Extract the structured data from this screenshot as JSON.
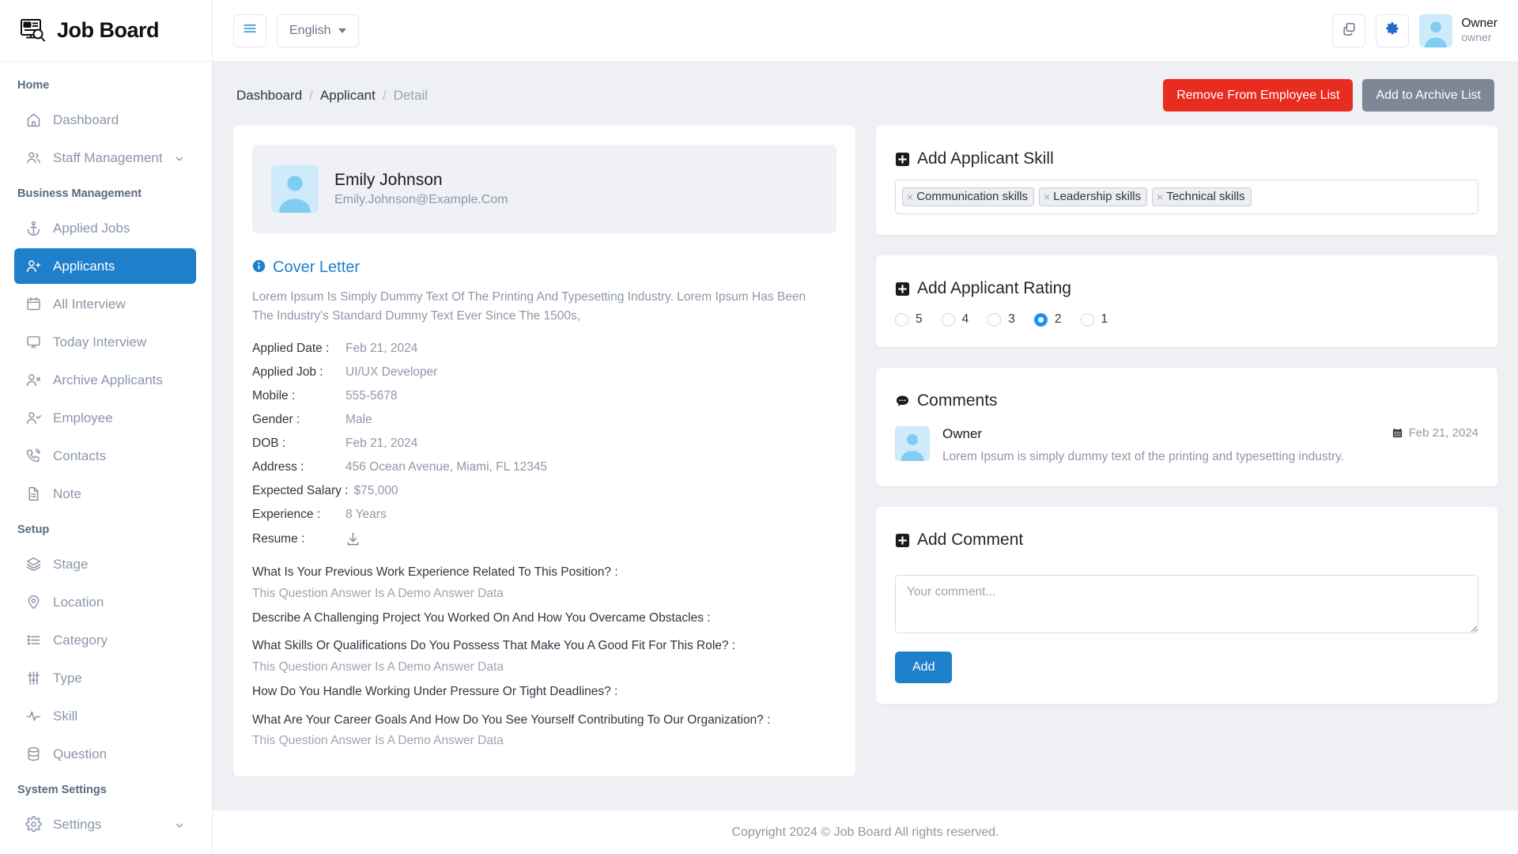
{
  "brand": {
    "name": "Job Board",
    "logo_icon": "job-certificate-search-icon"
  },
  "sidebar": {
    "sections": [
      {
        "label": "Home",
        "items": [
          {
            "label": "Dashboard",
            "icon": "home-icon",
            "active": false
          },
          {
            "label": "Staff Management",
            "icon": "users-icon",
            "active": false,
            "chevron": "chevron-down-icon"
          }
        ]
      },
      {
        "label": "Business Management",
        "items": [
          {
            "label": "Applied Jobs",
            "icon": "anchor-icon",
            "active": false
          },
          {
            "label": "Applicants",
            "icon": "user-plus-icon",
            "active": true
          },
          {
            "label": "All Interview",
            "icon": "calendar-icon",
            "active": false
          },
          {
            "label": "Today Interview",
            "icon": "screen-icon",
            "active": false
          },
          {
            "label": "Archive Applicants",
            "icon": "user-x-icon",
            "active": false
          },
          {
            "label": "Employee",
            "icon": "user-check-icon",
            "active": false
          },
          {
            "label": "Contacts",
            "icon": "phone-call-icon",
            "active": false
          },
          {
            "label": "Note",
            "icon": "file-text-icon",
            "active": false
          }
        ]
      },
      {
        "label": "Setup",
        "items": [
          {
            "label": "Stage",
            "icon": "layers-icon",
            "active": false
          },
          {
            "label": "Location",
            "icon": "map-pin-icon",
            "active": false
          },
          {
            "label": "Category",
            "icon": "list-icon",
            "active": false
          },
          {
            "label": "Type",
            "icon": "sliders-icon",
            "active": false
          },
          {
            "label": "Skill",
            "icon": "activity-icon",
            "active": false
          },
          {
            "label": "Question",
            "icon": "database-icon",
            "active": false
          }
        ]
      },
      {
        "label": "System Settings",
        "items": [
          {
            "label": "Settings",
            "icon": "gear-icon",
            "active": false,
            "chevron": "chevron-down-icon"
          }
        ]
      }
    ]
  },
  "topbar": {
    "menu_icon": "hamburger-icon",
    "language": "English",
    "copy_icon": "copy-icon",
    "settings_icon": "gear-icon",
    "user": {
      "name": "Owner",
      "role": "owner",
      "avatar_icon": "user-avatar-icon"
    }
  },
  "breadcrumb": {
    "items": [
      {
        "label": "Dashboard",
        "muted": false
      },
      {
        "label": "Applicant",
        "muted": false
      },
      {
        "label": "Detail",
        "muted": true
      }
    ],
    "separator": "/"
  },
  "page_actions": {
    "remove_label": "Remove From Employee List",
    "archive_label": "Add to Archive List",
    "remove_color": "#e92c20",
    "archive_color": "#7d8796"
  },
  "applicant": {
    "name": "Emily Johnson",
    "email": "Emily.Johnson@Example.Com",
    "avatar_icon": "user-avatar-icon",
    "cover_letter": {
      "icon": "info-circle-icon",
      "title": "Cover Letter",
      "text": "Lorem Ipsum Is Simply Dummy Text Of The Printing And Typesetting Industry. Lorem Ipsum Has Been The Industry's Standard Dummy Text Ever Since The 1500s,"
    },
    "fields": [
      {
        "label": "Applied Date :",
        "value": "Feb 21, 2024"
      },
      {
        "label": "Applied Job :",
        "value": "UI/UX Developer"
      },
      {
        "label": "Mobile :",
        "value": "555-5678"
      },
      {
        "label": "Gender :",
        "value": "Male"
      },
      {
        "label": "DOB :",
        "value": "Feb 21, 2024"
      },
      {
        "label": "Address :",
        "value": "456 Ocean Avenue, Miami, FL 12345"
      }
    ],
    "salary_label": "Expected Salary :",
    "salary_value": "$75,000",
    "experience_label": "Experience :",
    "experience_value": "8 Years",
    "resume_label": "Resume :",
    "resume_icon": "download-icon",
    "questions": [
      {
        "q": "What Is Your Previous Work Experience Related To This Position? :",
        "a": "This Question Answer Is A Demo Answer Data"
      },
      {
        "q": "Describe A Challenging Project You Worked On And How You Overcame Obstacles :",
        "a": ""
      },
      {
        "q": "What Skills Or Qualifications Do You Possess That Make You A Good Fit For This Role? :",
        "a": "This Question Answer Is A Demo Answer Data"
      },
      {
        "q": "How Do You Handle Working Under Pressure Or Tight Deadlines? :",
        "a": ""
      },
      {
        "q": "What Are Your Career Goals And How Do You See Yourself Contributing To Our Organization? :",
        "a": "This Question Answer Is A Demo Answer Data"
      }
    ]
  },
  "skill_card": {
    "icon": "plus-square-icon",
    "title": "Add Applicant Skill",
    "tags": [
      "Communication skills",
      "Leadership skills",
      "Technical skills"
    ],
    "remove_glyph": "×"
  },
  "rating_card": {
    "icon": "plus-square-icon",
    "title": "Add Applicant Rating",
    "options": [
      "5",
      "4",
      "3",
      "2",
      "1"
    ],
    "selected": "2",
    "accent": "#1e90f5"
  },
  "comments_card": {
    "icon": "comment-icon",
    "title": "Comments",
    "items": [
      {
        "author": "Owner",
        "avatar_icon": "user-avatar-icon",
        "date": "Feb 21, 2024",
        "date_icon": "calendar-icon",
        "text": "Lorem Ipsum is simply dummy text of the printing and typesetting industry."
      }
    ]
  },
  "add_comment_card": {
    "icon": "plus-square-icon",
    "title": "Add Comment",
    "placeholder": "Your comment...",
    "value": "",
    "add_label": "Add",
    "accent": "#1e7fcb"
  },
  "footer": {
    "text": "Copyright 2024 © Job Board All rights reserved."
  }
}
